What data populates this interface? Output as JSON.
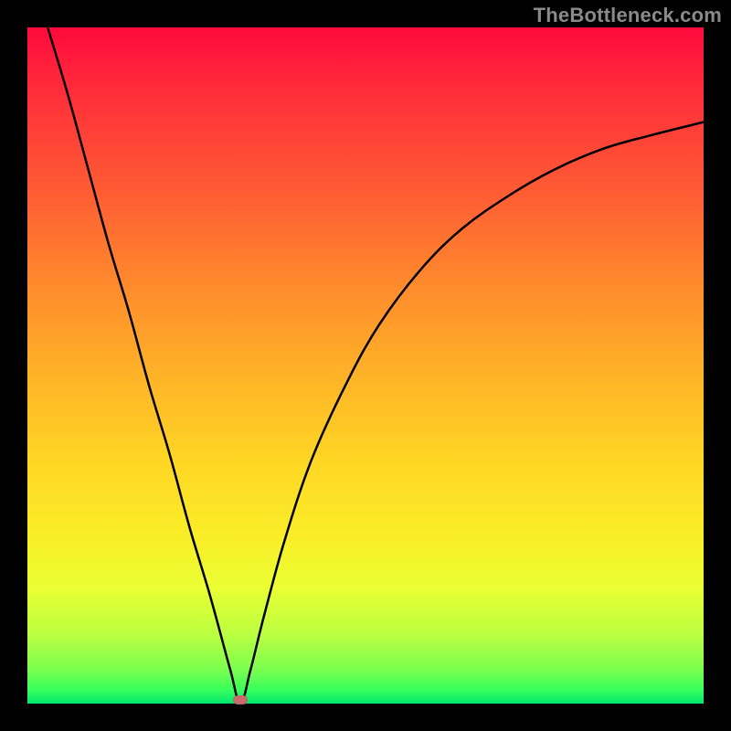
{
  "watermark": {
    "text": "TheBottleneck.com"
  },
  "chart_data": {
    "type": "line",
    "title": "",
    "xlabel": "",
    "ylabel": "",
    "xlim": [
      0,
      100
    ],
    "ylim": [
      0,
      100
    ],
    "grid": false,
    "axes_visible": false,
    "background_gradient": {
      "orientation": "vertical",
      "stops": [
        {
          "pos": 0.0,
          "color": "#ff0a3c"
        },
        {
          "pos": 0.25,
          "color": "#ff5e33"
        },
        {
          "pos": 0.5,
          "color": "#ffb427"
        },
        {
          "pos": 0.75,
          "color": "#f9ef28"
        },
        {
          "pos": 1.0,
          "color": "#00e86e"
        }
      ]
    },
    "series": [
      {
        "name": "v-curve",
        "stroke": "#000000",
        "stroke_width": 2.5,
        "x": [
          3,
          6,
          9,
          12,
          15,
          18,
          21,
          24,
          27,
          30,
          31.5,
          33,
          35,
          38,
          42,
          47,
          52,
          58,
          64,
          71,
          78,
          85,
          92,
          100
        ],
        "y": [
          100,
          90,
          79,
          68,
          58,
          47,
          37,
          26,
          16,
          5,
          0,
          5,
          13,
          24,
          36,
          47,
          56,
          64,
          70,
          75,
          79,
          82,
          84,
          86
        ]
      }
    ],
    "annotations": [
      {
        "name": "bottleneck-marker",
        "shape": "pill",
        "color": "#cb6a6c",
        "x": 31.5,
        "y": 0.5
      }
    ]
  }
}
